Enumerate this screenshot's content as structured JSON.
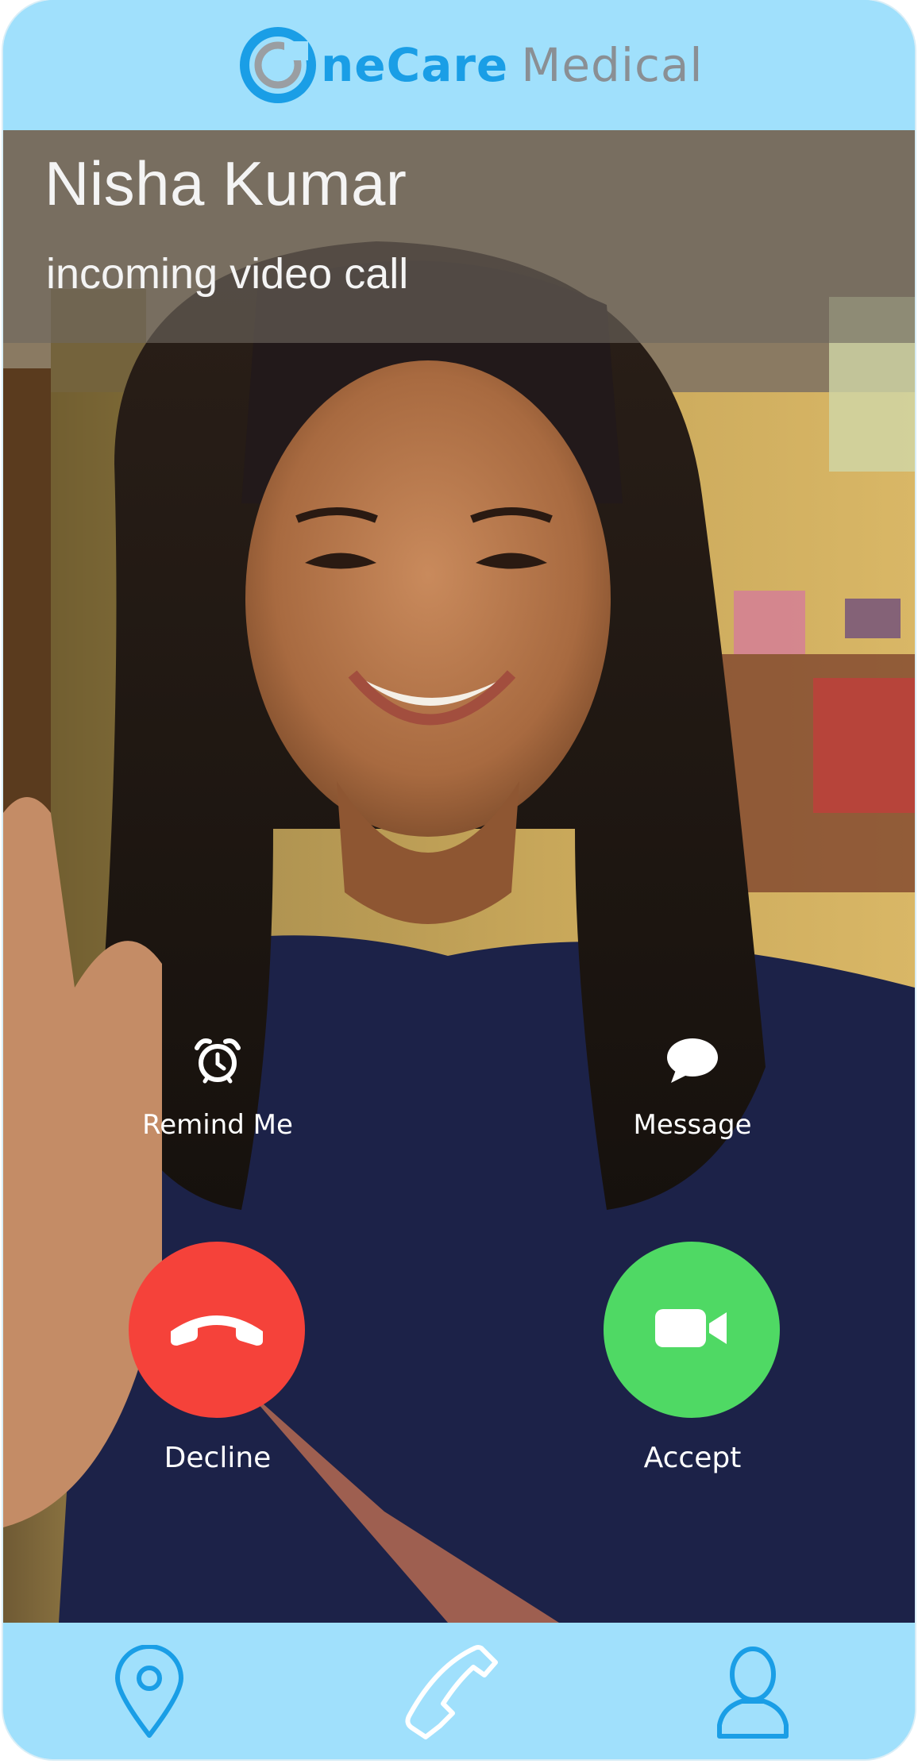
{
  "app": {
    "brand_part1": "neCare",
    "brand_part2": "Medical",
    "brand_color": "#1a9ee6",
    "header_color": "#a0e0fc"
  },
  "call": {
    "caller_name": "Nisha Kumar",
    "status": "incoming video call"
  },
  "actions": {
    "remind_label": "Remind Me",
    "remind_icon": "alarm-clock-icon",
    "message_label": "Message",
    "message_icon": "speech-bubble-icon",
    "decline_label": "Decline",
    "decline_icon": "hang-up-phone-icon",
    "decline_color": "#f5423a",
    "accept_label": "Accept",
    "accept_icon": "video-camera-icon",
    "accept_color": "#4fd964"
  },
  "nav": {
    "items": [
      {
        "icon": "location-pin-icon"
      },
      {
        "icon": "phone-icon"
      },
      {
        "icon": "user-profile-icon"
      }
    ],
    "icon_color": "#1a9ee6"
  }
}
